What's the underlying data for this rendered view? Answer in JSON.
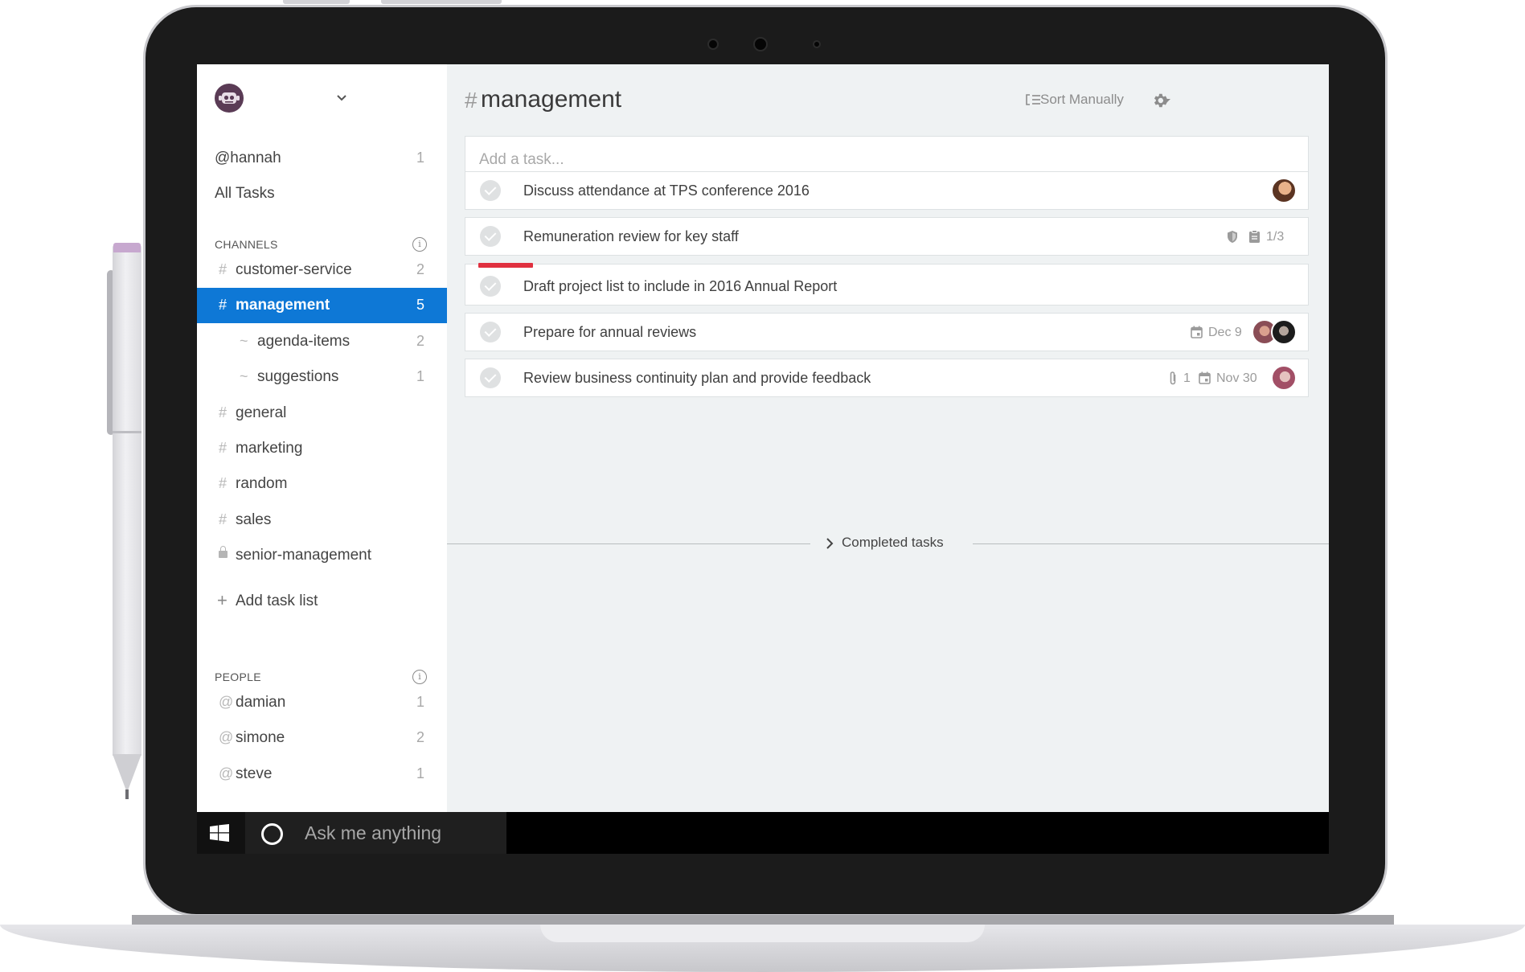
{
  "sidebar": {
    "user": {
      "handle": "@hannah",
      "count": "1"
    },
    "all_tasks": "All Tasks",
    "channels_header": "CHANNELS",
    "channels": [
      {
        "prefix": "#",
        "name": "customer-service",
        "count": "2",
        "active": false,
        "sub": false
      },
      {
        "prefix": "#",
        "name": "management",
        "count": "5",
        "active": true,
        "sub": false
      },
      {
        "prefix": "~",
        "name": "agenda-items",
        "count": "2",
        "active": false,
        "sub": true
      },
      {
        "prefix": "~",
        "name": "suggestions",
        "count": "1",
        "active": false,
        "sub": true
      },
      {
        "prefix": "#",
        "name": "general",
        "count": "",
        "active": false,
        "sub": false
      },
      {
        "prefix": "#",
        "name": "marketing",
        "count": "",
        "active": false,
        "sub": false
      },
      {
        "prefix": "#",
        "name": "random",
        "count": "",
        "active": false,
        "sub": false
      },
      {
        "prefix": "#",
        "name": "sales",
        "count": "",
        "active": false,
        "sub": false
      },
      {
        "prefix": "lock",
        "name": "senior-management",
        "count": "",
        "active": false,
        "sub": false
      }
    ],
    "add_task_list": "Add task list",
    "add_task_list_icon": "+",
    "people_header": "PEOPLE",
    "people": [
      {
        "prefix": "@",
        "name": "damian",
        "count": "1"
      },
      {
        "prefix": "@",
        "name": "simone",
        "count": "2"
      },
      {
        "prefix": "@",
        "name": "steve",
        "count": "1"
      }
    ]
  },
  "main": {
    "title_prefix": "#",
    "title": "management",
    "sort_label": "Sort Manually",
    "add_task_placeholder": "Add a task...",
    "tasks": [
      {
        "text": "Discuss attendance at TPS conference 2016"
      },
      {
        "text": "Remuneration review for key staff",
        "checklist": "1/3"
      },
      {
        "text": "Draft project list to include in 2016 Annual Report",
        "priority": "high"
      },
      {
        "text": "Prepare for annual reviews",
        "due": "Dec 9"
      },
      {
        "text": "Review business continuity plan and provide feedback",
        "attachments": "1",
        "due": "Nov 30"
      }
    ],
    "completed_label": "Completed tasks"
  },
  "taskbar": {
    "search_placeholder": "Ask me anything"
  },
  "colors": {
    "accent": "#0e78d6",
    "priority": "#e0303f",
    "logo": "#5a3b55"
  },
  "icons": [
    "logo-icon",
    "chevron-down-icon",
    "info-icon",
    "lock-icon",
    "plus-icon",
    "sort-icon",
    "gear-icon",
    "checkmark-icon",
    "shield-icon",
    "checklist-icon",
    "calendar-icon",
    "paperclip-icon",
    "windows-icon",
    "cortana-icon",
    "chevron-right-icon"
  ]
}
